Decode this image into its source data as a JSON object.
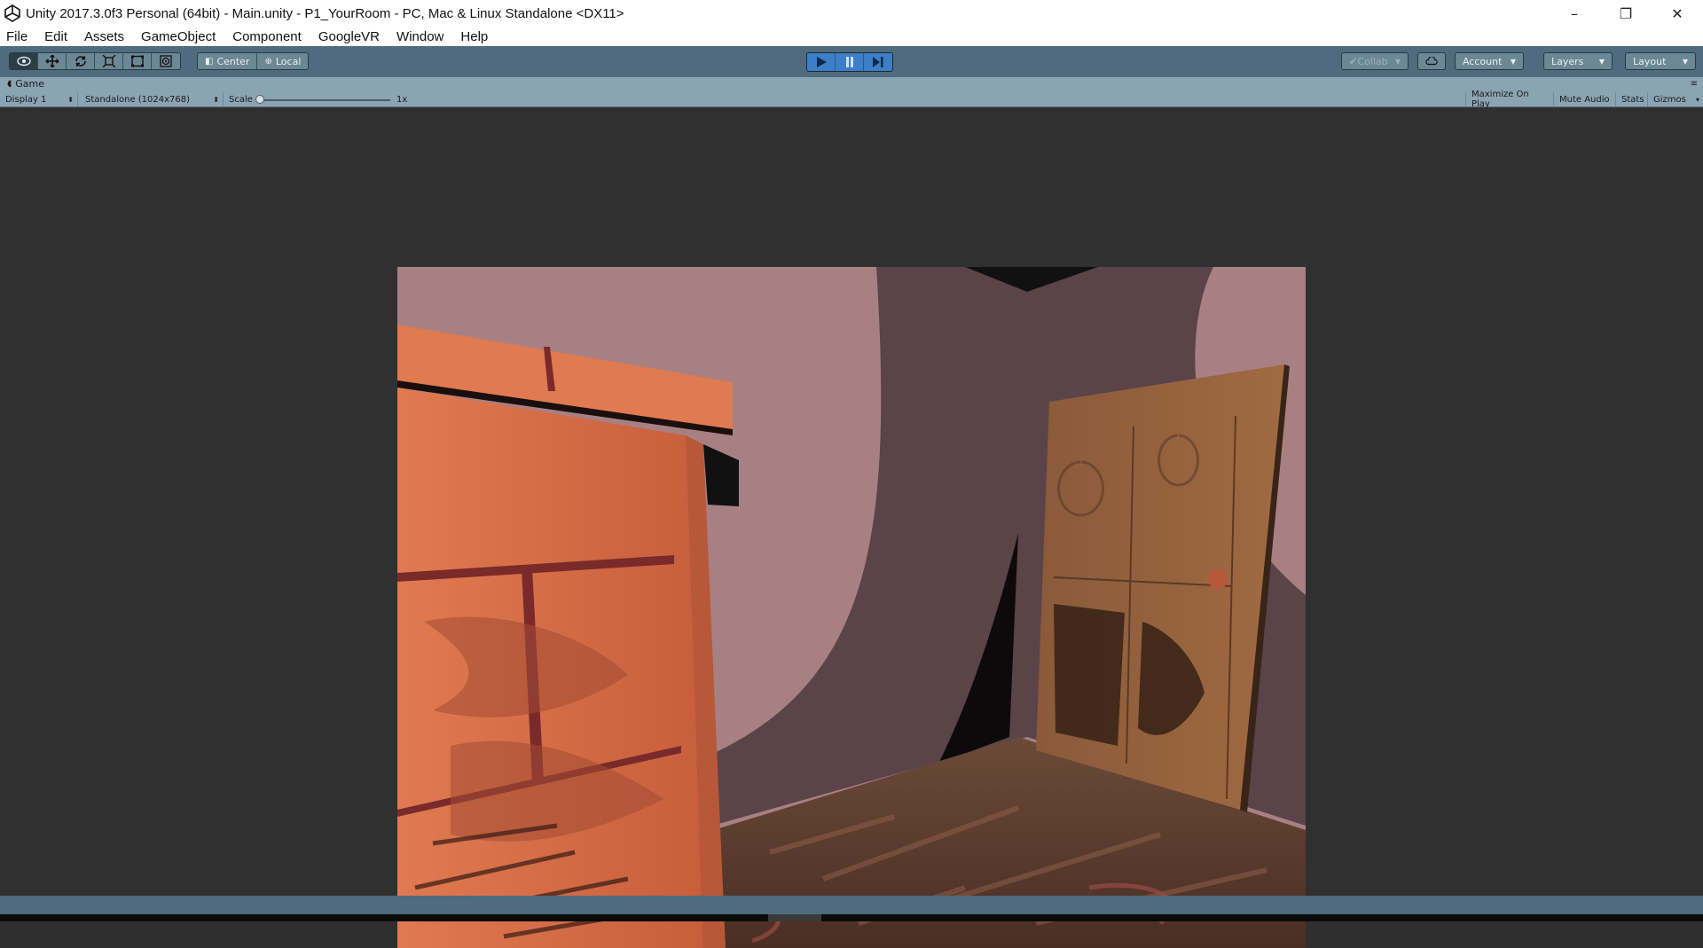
{
  "window": {
    "title": "Unity 2017.3.0f3 Personal (64bit) - Main.unity - P1_YourRoom - PC, Mac & Linux Standalone <DX11>",
    "controls": {
      "minimize": "–",
      "restore": "❐",
      "close": "✕"
    }
  },
  "menu": {
    "items": [
      "File",
      "Edit",
      "Assets",
      "GameObject",
      "Component",
      "GoogleVR",
      "Window",
      "Help"
    ]
  },
  "toolbar": {
    "tools": [
      "hand-tool",
      "move-tool",
      "rotate-tool",
      "scale-tool",
      "rect-tool",
      "transform-tool"
    ],
    "pivot_center": "Center",
    "pivot_local": "Local",
    "collab": "Collab",
    "account": "Account",
    "layers": "Layers",
    "layout": "Layout"
  },
  "game_view": {
    "tab_label": "Game",
    "display": "Display 1",
    "resolution": "Standalone (1024x768)",
    "scale_label": "Scale",
    "scale_value": "1x",
    "scale_level": 0,
    "maximize_on_play": "Maximize On Play",
    "mute_audio": "Mute Audio",
    "stats": "Stats",
    "gizmos": "Gizmos"
  },
  "colors": {
    "toolbar_bg": "#4f6b7d",
    "header_bg": "#8aa4b3",
    "play_active": "#3c7ec7",
    "viewport_bg": "#303030"
  }
}
